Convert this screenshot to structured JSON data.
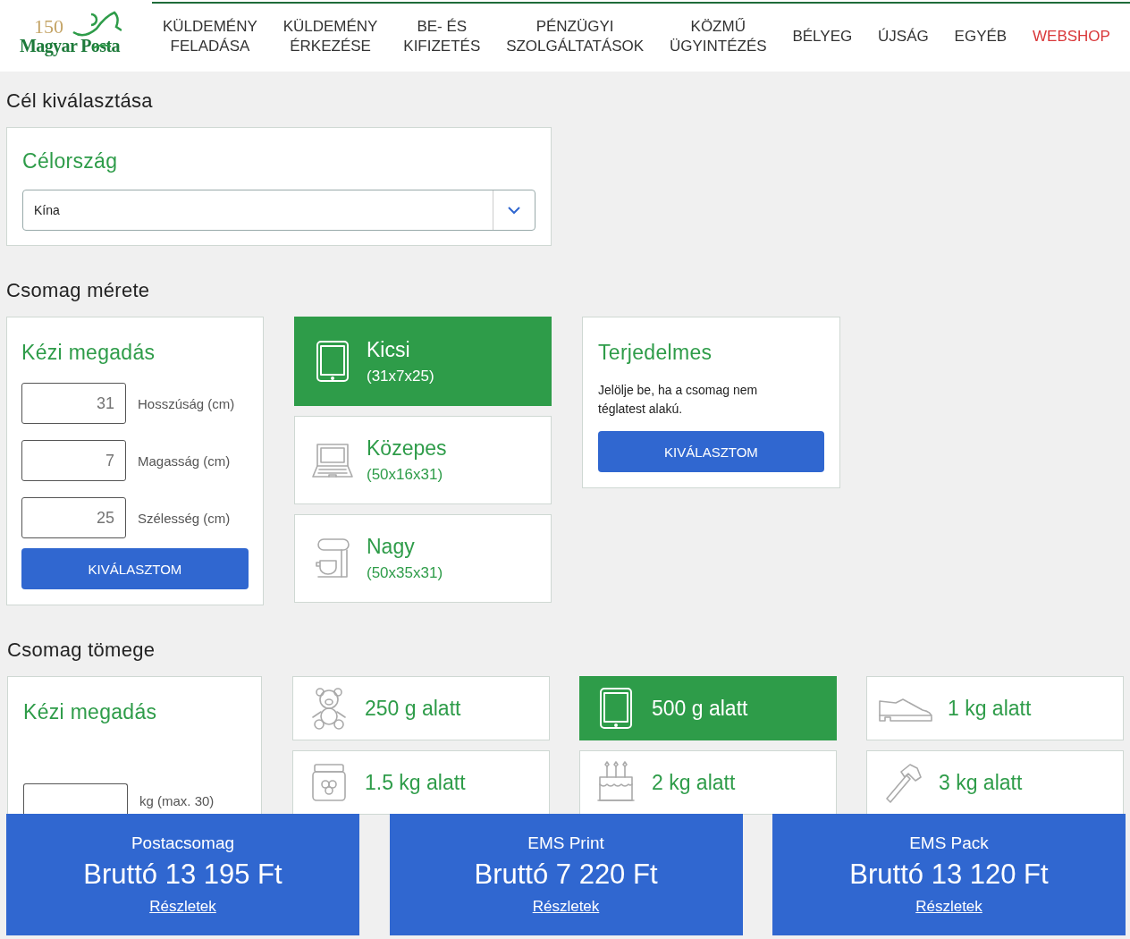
{
  "header": {
    "logo": {
      "number": "150",
      "name": "Magyar Posta"
    },
    "nav": [
      {
        "lines": [
          "KÜLDEMÉNY",
          "FELADÁSA"
        ],
        "highlighted": false
      },
      {
        "lines": [
          "KÜLDEMÉNY",
          "ÉRKEZÉSE"
        ],
        "highlighted": false
      },
      {
        "lines": [
          "BE- ÉS",
          "KIFIZETÉS"
        ],
        "highlighted": false
      },
      {
        "lines": [
          "PÉNZÜGYI",
          "SZOLGÁLTATÁSOK"
        ],
        "highlighted": false
      },
      {
        "lines": [
          "KÖZMŰ",
          "ÜGYINTÉZÉS"
        ],
        "highlighted": false
      },
      {
        "lines": [
          "BÉLYEG"
        ],
        "highlighted": false
      },
      {
        "lines": [
          "ÚJSÁG"
        ],
        "highlighted": false
      },
      {
        "lines": [
          "EGYÉB"
        ],
        "highlighted": false
      },
      {
        "lines": [
          "WEBSHOP"
        ],
        "highlighted": true
      }
    ]
  },
  "destination": {
    "heading": "Cél kiválasztása",
    "title": "Célország",
    "value": "Kína"
  },
  "size": {
    "heading": "Csomag mérete",
    "manual": {
      "title": "Kézi megadás",
      "fields": [
        {
          "placeholder": "31",
          "label": "Hosszúság (cm)"
        },
        {
          "placeholder": "7",
          "label": "Magasság (cm)"
        },
        {
          "placeholder": "25",
          "label": "Szélesség (cm)"
        }
      ],
      "button": "KIVÁLASZTOM"
    },
    "options": [
      {
        "kind": "tablet",
        "name": "Kicsi",
        "dims": "(31x7x25)",
        "selected": true
      },
      {
        "kind": "laptop",
        "name": "Közepes",
        "dims": "(50x16x31)",
        "selected": false
      },
      {
        "kind": "mixer",
        "name": "Nagy",
        "dims": "(50x35x31)",
        "selected": false
      }
    ],
    "bulky": {
      "title": "Terjedelmes",
      "text": "Jelölje be, ha a csomag nem téglatest alakú.",
      "button": "KIVÁLASZTOM"
    }
  },
  "weight": {
    "heading": "Csomag tömege",
    "manual": {
      "title": "Kézi megadás",
      "unit": "kg (max. 30)"
    },
    "options": [
      {
        "kind": "teddy",
        "label": "250 g alatt",
        "selected": false
      },
      {
        "kind": "tablet",
        "label": "500 g alatt",
        "selected": true
      },
      {
        "kind": "shoe",
        "label": "1 kg alatt",
        "selected": false
      },
      {
        "kind": "jar",
        "label": "1.5 kg alatt",
        "selected": false
      },
      {
        "kind": "cake",
        "label": "2 kg alatt",
        "selected": false
      },
      {
        "kind": "hammer",
        "label": "3 kg alatt",
        "selected": false
      }
    ]
  },
  "results": [
    {
      "name": "Postacsomag",
      "price": "Bruttó 13 195 Ft",
      "link": "Részletek"
    },
    {
      "name": "EMS Print",
      "price": "Bruttó 7 220 Ft",
      "link": "Részletek"
    },
    {
      "name": "EMS Pack",
      "price": "Bruttó 13 120 Ft",
      "link": "Részletek"
    }
  ]
}
